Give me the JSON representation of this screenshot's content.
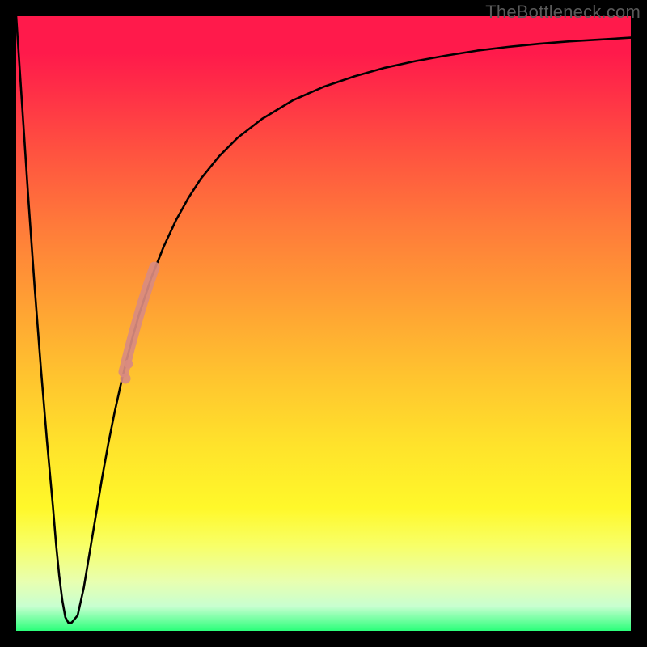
{
  "watermark": {
    "text": "TheBottleneck.com"
  },
  "colors": {
    "frame": "#000000",
    "curve": "#000000",
    "highlight": "#d98b80"
  },
  "chart_data": {
    "type": "line",
    "title": "",
    "xlabel": "",
    "ylabel": "",
    "xlim": [
      0,
      100
    ],
    "ylim": [
      0,
      100
    ],
    "grid": false,
    "legend": false,
    "annotations": [
      "TheBottleneck.com"
    ],
    "series": [
      {
        "name": "curve",
        "x": [
          0,
          1,
          2,
          3,
          4,
          5,
          6,
          6.5,
          7,
          7.5,
          8,
          8.5,
          9,
          10,
          11,
          12,
          13,
          14,
          15,
          16,
          17,
          18,
          19,
          20,
          22,
          24,
          26,
          28,
          30,
          33,
          36,
          40,
          45,
          50,
          55,
          60,
          65,
          70,
          75,
          80,
          85,
          90,
          95,
          100
        ],
        "y": [
          100,
          85,
          70,
          56,
          43,
          31,
          20,
          14,
          9,
          5,
          2.2,
          1.3,
          1.3,
          2.5,
          7,
          13,
          19,
          25,
          30.5,
          35.5,
          40,
          44.2,
          48,
          51.5,
          57.5,
          62.5,
          66.8,
          70.4,
          73.5,
          77.2,
          80.2,
          83.3,
          86.3,
          88.5,
          90.2,
          91.6,
          92.7,
          93.6,
          94.4,
          95,
          95.5,
          95.9,
          96.2,
          96.5
        ]
      }
    ],
    "highlight_segment": {
      "series": "curve",
      "x_range": [
        17.5,
        22.5
      ],
      "note": "thick pink marker cluster along the curve"
    },
    "background_gradient": {
      "top_color": "#ff1a4b",
      "bottom_color": "#2bff7a",
      "meaning": "red = worse, green = better"
    }
  }
}
